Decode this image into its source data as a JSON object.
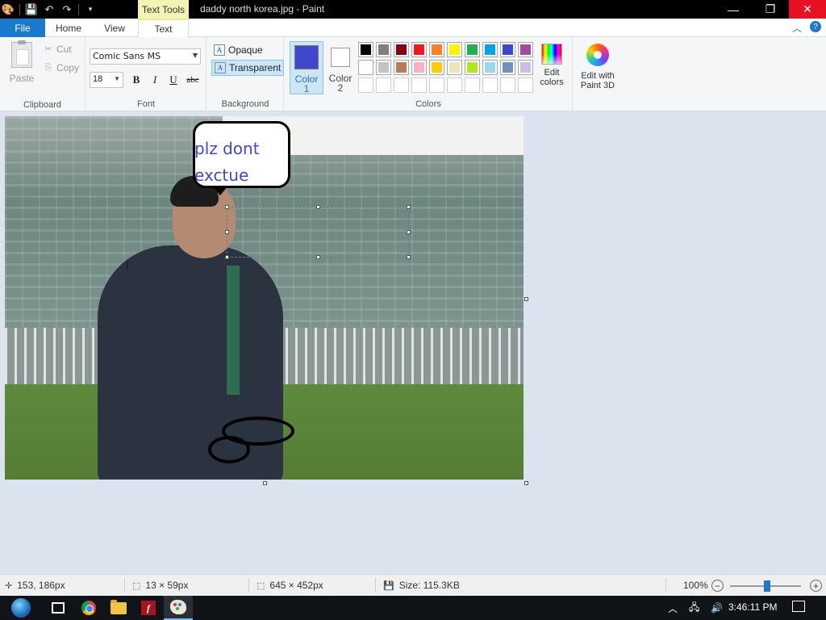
{
  "window": {
    "title": "daddy north korea.jpg - Paint",
    "context_tab": "Text Tools",
    "buttons": {
      "minimize": "—",
      "maximize": "❐",
      "close": "✕"
    }
  },
  "quick_access": {
    "app_icon": "paint-icon",
    "save": "save-icon",
    "undo": "undo-icon",
    "redo": "redo-icon",
    "customize": "dropdown-icon"
  },
  "tabs": [
    {
      "label": "File"
    },
    {
      "label": "Home"
    },
    {
      "label": "View"
    },
    {
      "label": "Text"
    }
  ],
  "ribbon": {
    "clipboard": {
      "label": "Clipboard",
      "paste": "Paste",
      "cut": "Cut",
      "copy": "Copy"
    },
    "font": {
      "label": "Font",
      "family": "Comic Sans MS",
      "size": "18",
      "bold": "B",
      "italic": "I",
      "underline": "U",
      "strikethrough": "abc"
    },
    "background": {
      "label": "Background",
      "opaque": "Opaque",
      "transparent": "Transparent",
      "selected": "Transparent"
    },
    "colors": {
      "label": "Colors",
      "color1_label": "Color\n1",
      "color2_label": "Color\n2",
      "color1": "#3f48cc",
      "color2": "#ffffff",
      "palette": [
        "#000000",
        "#7f7f7f",
        "#880015",
        "#ed1c24",
        "#ff7f27",
        "#fff200",
        "#22b14c",
        "#00a2e8",
        "#3f48cc",
        "#a349a4",
        "#ffffff",
        "#c3c3c3",
        "#b97a57",
        "#ffaec9",
        "#ffc90e",
        "#efe4b0",
        "#b5e61d",
        "#99d9ea",
        "#7092be",
        "#c8bfe7",
        "#ffffff",
        "#ffffff",
        "#ffffff",
        "#ffffff",
        "#ffffff",
        "#ffffff",
        "#ffffff",
        "#ffffff",
        "#ffffff",
        "#ffffff"
      ],
      "edit_colors": "Edit\ncolors"
    },
    "paint3d": {
      "label": "Edit with\nPaint 3D"
    }
  },
  "canvas": {
    "bubble_text": "plz dont\nexctue\nme",
    "text_color": "#3f48cc"
  },
  "status": {
    "cursor_pos": "153, 186px",
    "selection_size": "13 × 59px",
    "image_size": "645 × 452px",
    "file_size": "Size: 115.3KB",
    "zoom": "100%",
    "zoom_level": 1.0
  },
  "taskbar": {
    "clock": "3:46:11 PM",
    "apps": [
      "start",
      "task-view",
      "chrome",
      "file-explorer",
      "flash",
      "paint"
    ]
  }
}
